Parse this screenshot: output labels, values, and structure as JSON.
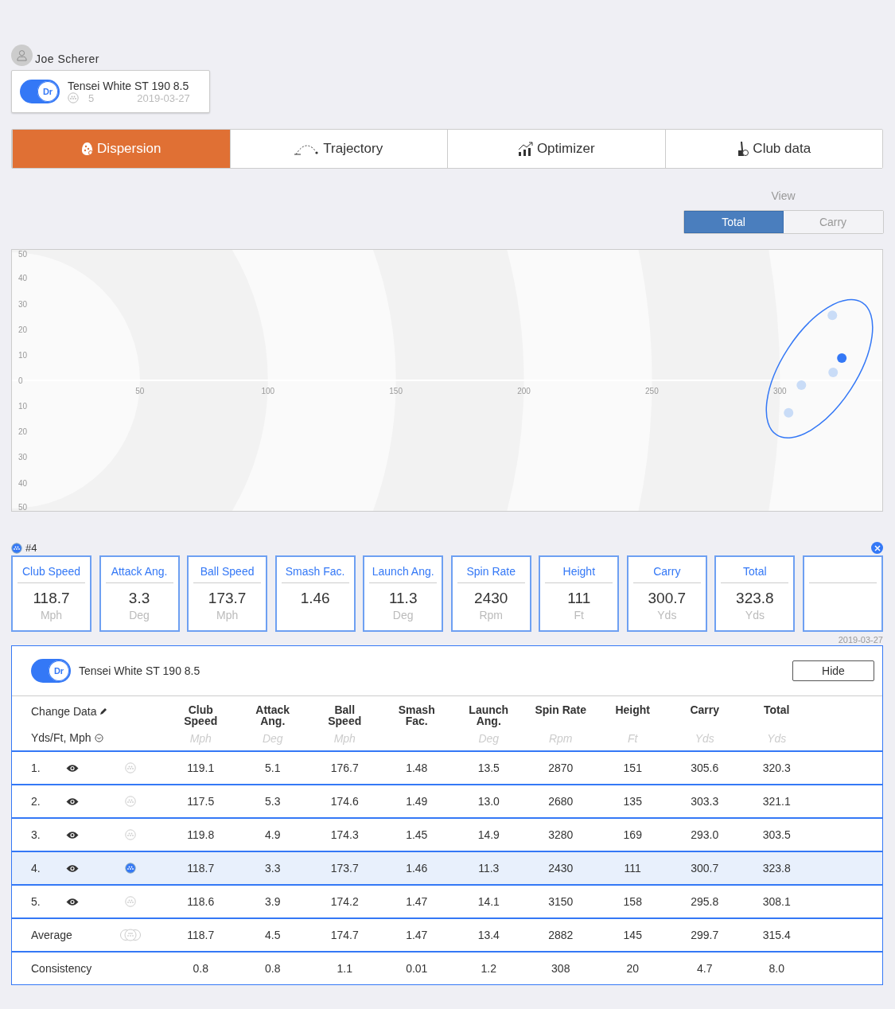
{
  "player": {
    "name": "Joe Scherer"
  },
  "club": {
    "badge": "Dr",
    "on": true,
    "name": "Tensei White ST 190 8.5",
    "shots": "5",
    "date": "2019-03-27"
  },
  "tabs": [
    {
      "kind": "dispersion",
      "label": "Dispersion",
      "selected": true
    },
    {
      "kind": "trajectory",
      "label": "Trajectory",
      "selected": false
    },
    {
      "kind": "optimizer",
      "label": "Optimizer",
      "selected": false
    },
    {
      "kind": "club",
      "label": "Club data",
      "selected": false
    }
  ],
  "view": {
    "label": "View",
    "options": [
      {
        "label": "Total",
        "selected": true
      },
      {
        "label": "Carry",
        "selected": false
      }
    ]
  },
  "dispersion": {
    "chart_data": {
      "type": "scatter",
      "xlim": [
        0,
        340
      ],
      "ylim": [
        -51,
        51
      ],
      "xticks": [
        50,
        100,
        150,
        200,
        250,
        300
      ],
      "yticks": [
        {
          "value": 50,
          "label": "50"
        },
        {
          "value": 40,
          "label": "40"
        },
        {
          "value": 30,
          "label": "30"
        },
        {
          "value": 20,
          "label": "20"
        },
        {
          "value": 10,
          "label": "10"
        },
        {
          "value": 0,
          "label": "0"
        },
        {
          "value": -10,
          "label": "10"
        },
        {
          "value": -20,
          "label": "20"
        },
        {
          "value": -30,
          "label": "30"
        },
        {
          "value": -40,
          "label": "40"
        },
        {
          "value": -50,
          "label": "50"
        }
      ],
      "x": [
        320.5,
        324.2,
        320.8,
        308.4,
        303.4
      ],
      "series": [
        {
          "color": "#c9dcf7",
          "values": [
            25.4,
            null,
            3.1,
            -1.9,
            -12.7
          ]
        },
        {
          "color": "#3478f6",
          "values": [
            null,
            8.7,
            null,
            null,
            null
          ]
        }
      ]
    }
  },
  "shot": {
    "label": "#4",
    "date": "2019-03-27",
    "metrics": [
      {
        "label": "Club Speed",
        "value": "118.7",
        "unit": "Mph"
      },
      {
        "label": "Attack Ang.",
        "value": "3.3",
        "unit": "Deg"
      },
      {
        "label": "Ball Speed",
        "value": "173.7",
        "unit": "Mph"
      },
      {
        "label": "Smash Fac.",
        "value": "1.46"
      },
      {
        "label": "Launch Ang.",
        "value": "11.3",
        "unit": "Deg"
      },
      {
        "label": "Spin Rate",
        "value": "2430",
        "unit": "Rpm"
      },
      {
        "label": "Height",
        "value": "111",
        "unit": "Ft"
      },
      {
        "label": "Carry",
        "value": "300.7",
        "unit": "Yds"
      },
      {
        "label": "Total",
        "value": "323.8",
        "unit": "Yds"
      }
    ]
  },
  "table": {
    "club": {
      "badge": "Dr",
      "on": true,
      "name": "Tensei White ST 190 8.5"
    },
    "hide_button": "Hide",
    "change_data": "Change Data",
    "units_setting": "Yds/Ft, Mph",
    "columns": [
      {
        "label": "Club Speed",
        "unit": "Mph"
      },
      {
        "label": "Attack Ang.",
        "unit": "Deg"
      },
      {
        "label": "Ball Speed",
        "unit": "Mph"
      },
      {
        "label": "Smash Fac."
      },
      {
        "label": "Launch Ang.",
        "unit": "Deg"
      },
      {
        "label": "Spin Rate",
        "unit": "Rpm"
      },
      {
        "label": "Height",
        "unit": "Ft"
      },
      {
        "label": "Carry",
        "unit": "Yds"
      },
      {
        "label": "Total",
        "unit": "Yds"
      }
    ],
    "rows": [
      {
        "index": "1.",
        "visible": true,
        "selected": false,
        "cells": [
          "119.1",
          "5.1",
          "176.7",
          "1.48",
          "13.5",
          "2870",
          "151",
          "305.6",
          "320.3"
        ]
      },
      {
        "index": "2.",
        "visible": true,
        "selected": false,
        "cells": [
          "117.5",
          "5.3",
          "174.6",
          "1.49",
          "13.0",
          "2680",
          "135",
          "303.3",
          "321.1"
        ]
      },
      {
        "index": "3.",
        "visible": true,
        "selected": false,
        "cells": [
          "119.8",
          "4.9",
          "174.3",
          "1.45",
          "14.9",
          "3280",
          "169",
          "293.0",
          "303.5"
        ]
      },
      {
        "index": "4.",
        "visible": true,
        "selected": true,
        "cells": [
          "118.7",
          "3.3",
          "173.7",
          "1.46",
          "11.3",
          "2430",
          "111",
          "300.7",
          "323.8"
        ]
      },
      {
        "index": "5.",
        "visible": true,
        "selected": false,
        "cells": [
          "118.6",
          "3.9",
          "174.2",
          "1.47",
          "14.1",
          "3150",
          "158",
          "295.8",
          "308.1"
        ]
      }
    ],
    "summary": [
      {
        "kind": "average",
        "label": "Average",
        "cells": [
          "118.7",
          "4.5",
          "174.7",
          "1.47",
          "13.4",
          "2882",
          "145",
          "299.7",
          "315.4"
        ]
      },
      {
        "kind": "consistency",
        "label": "Consistency",
        "cells": [
          "0.8",
          "0.8",
          "1.1",
          "0.01",
          "1.2",
          "308",
          "20",
          "4.7",
          "8.0"
        ]
      }
    ]
  }
}
